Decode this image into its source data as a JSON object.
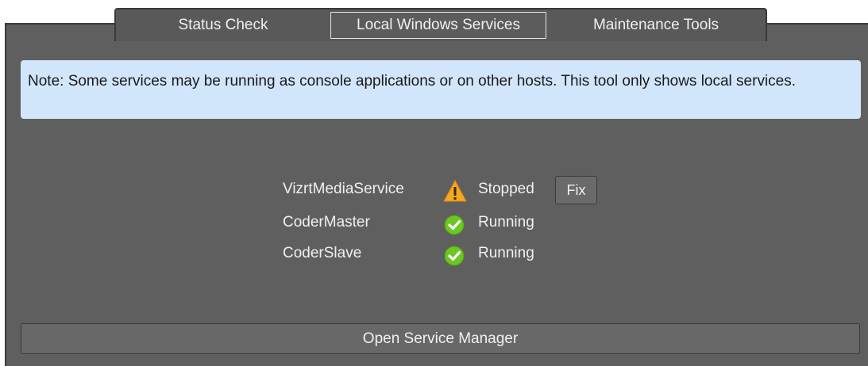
{
  "tabs": [
    {
      "label": "Status Check",
      "selected": false
    },
    {
      "label": "Local Windows Services",
      "selected": true
    },
    {
      "label": "Maintenance Tools",
      "selected": false
    }
  ],
  "note": {
    "text": "Note: Some services may be running as console applications or on other hosts. This tool only shows local services."
  },
  "services": [
    {
      "name": "VizrtMediaService",
      "status": "Stopped",
      "icon": "warning-icon",
      "action_label": "Fix"
    },
    {
      "name": "CoderMaster",
      "status": "Running",
      "icon": "check-circle-icon"
    },
    {
      "name": "CoderSlave",
      "status": "Running",
      "icon": "check-circle-icon"
    }
  ],
  "footer": {
    "open_service_manager_label": "Open Service Manager"
  },
  "colors": {
    "panel_bg": "#5f5f5f",
    "note_bg": "#d2e6fb",
    "warning": "#f5a623",
    "running": "#6cc623"
  }
}
